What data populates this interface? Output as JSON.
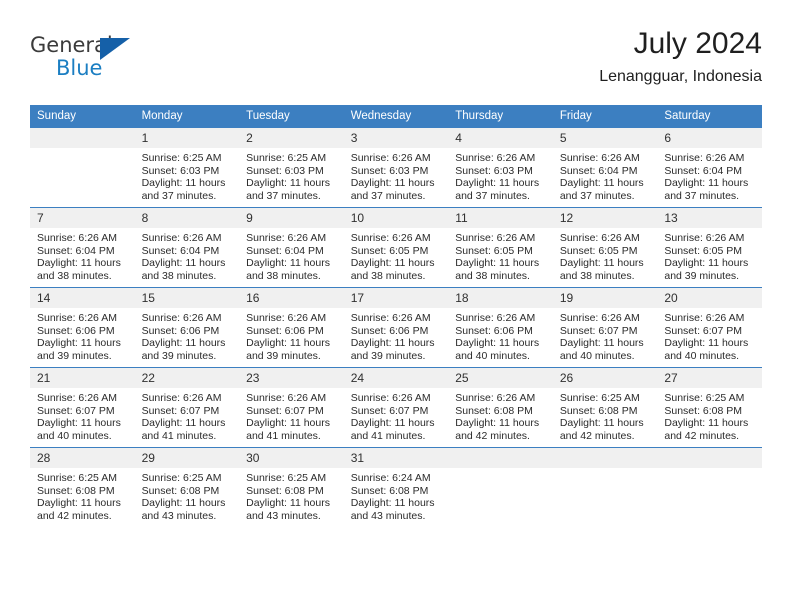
{
  "brand": {
    "name_top": "General",
    "name_bottom": "Blue",
    "triangle_color": "#1560a8",
    "blue_color": "#1b7ec2"
  },
  "header": {
    "title": "July 2024",
    "subtitle": "Lenangguar, Indonesia"
  },
  "theme": {
    "header_blue": "#3c7fc1",
    "daynum_band": "#f0f0f0",
    "grid_line": "#3c7fc1"
  },
  "weekdays": [
    "Sunday",
    "Monday",
    "Tuesday",
    "Wednesday",
    "Thursday",
    "Friday",
    "Saturday"
  ],
  "labels": {
    "sunrise": "Sunrise:",
    "sunset": "Sunset:",
    "daylight": "Daylight:"
  },
  "weeks": [
    [
      {
        "day": "",
        "sunrise": "",
        "sunset": "",
        "daylight": "",
        "empty": true
      },
      {
        "day": "1",
        "sunrise": "Sunrise: 6:25 AM",
        "sunset": "Sunset: 6:03 PM",
        "daylight": "Daylight: 11 hours and 37 minutes."
      },
      {
        "day": "2",
        "sunrise": "Sunrise: 6:25 AM",
        "sunset": "Sunset: 6:03 PM",
        "daylight": "Daylight: 11 hours and 37 minutes."
      },
      {
        "day": "3",
        "sunrise": "Sunrise: 6:26 AM",
        "sunset": "Sunset: 6:03 PM",
        "daylight": "Daylight: 11 hours and 37 minutes."
      },
      {
        "day": "4",
        "sunrise": "Sunrise: 6:26 AM",
        "sunset": "Sunset: 6:03 PM",
        "daylight": "Daylight: 11 hours and 37 minutes."
      },
      {
        "day": "5",
        "sunrise": "Sunrise: 6:26 AM",
        "sunset": "Sunset: 6:04 PM",
        "daylight": "Daylight: 11 hours and 37 minutes."
      },
      {
        "day": "6",
        "sunrise": "Sunrise: 6:26 AM",
        "sunset": "Sunset: 6:04 PM",
        "daylight": "Daylight: 11 hours and 37 minutes."
      }
    ],
    [
      {
        "day": "7",
        "sunrise": "Sunrise: 6:26 AM",
        "sunset": "Sunset: 6:04 PM",
        "daylight": "Daylight: 11 hours and 38 minutes."
      },
      {
        "day": "8",
        "sunrise": "Sunrise: 6:26 AM",
        "sunset": "Sunset: 6:04 PM",
        "daylight": "Daylight: 11 hours and 38 minutes."
      },
      {
        "day": "9",
        "sunrise": "Sunrise: 6:26 AM",
        "sunset": "Sunset: 6:04 PM",
        "daylight": "Daylight: 11 hours and 38 minutes."
      },
      {
        "day": "10",
        "sunrise": "Sunrise: 6:26 AM",
        "sunset": "Sunset: 6:05 PM",
        "daylight": "Daylight: 11 hours and 38 minutes."
      },
      {
        "day": "11",
        "sunrise": "Sunrise: 6:26 AM",
        "sunset": "Sunset: 6:05 PM",
        "daylight": "Daylight: 11 hours and 38 minutes."
      },
      {
        "day": "12",
        "sunrise": "Sunrise: 6:26 AM",
        "sunset": "Sunset: 6:05 PM",
        "daylight": "Daylight: 11 hours and 38 minutes."
      },
      {
        "day": "13",
        "sunrise": "Sunrise: 6:26 AM",
        "sunset": "Sunset: 6:05 PM",
        "daylight": "Daylight: 11 hours and 39 minutes."
      }
    ],
    [
      {
        "day": "14",
        "sunrise": "Sunrise: 6:26 AM",
        "sunset": "Sunset: 6:06 PM",
        "daylight": "Daylight: 11 hours and 39 minutes."
      },
      {
        "day": "15",
        "sunrise": "Sunrise: 6:26 AM",
        "sunset": "Sunset: 6:06 PM",
        "daylight": "Daylight: 11 hours and 39 minutes."
      },
      {
        "day": "16",
        "sunrise": "Sunrise: 6:26 AM",
        "sunset": "Sunset: 6:06 PM",
        "daylight": "Daylight: 11 hours and 39 minutes."
      },
      {
        "day": "17",
        "sunrise": "Sunrise: 6:26 AM",
        "sunset": "Sunset: 6:06 PM",
        "daylight": "Daylight: 11 hours and 39 minutes."
      },
      {
        "day": "18",
        "sunrise": "Sunrise: 6:26 AM",
        "sunset": "Sunset: 6:06 PM",
        "daylight": "Daylight: 11 hours and 40 minutes."
      },
      {
        "day": "19",
        "sunrise": "Sunrise: 6:26 AM",
        "sunset": "Sunset: 6:07 PM",
        "daylight": "Daylight: 11 hours and 40 minutes."
      },
      {
        "day": "20",
        "sunrise": "Sunrise: 6:26 AM",
        "sunset": "Sunset: 6:07 PM",
        "daylight": "Daylight: 11 hours and 40 minutes."
      }
    ],
    [
      {
        "day": "21",
        "sunrise": "Sunrise: 6:26 AM",
        "sunset": "Sunset: 6:07 PM",
        "daylight": "Daylight: 11 hours and 40 minutes."
      },
      {
        "day": "22",
        "sunrise": "Sunrise: 6:26 AM",
        "sunset": "Sunset: 6:07 PM",
        "daylight": "Daylight: 11 hours and 41 minutes."
      },
      {
        "day": "23",
        "sunrise": "Sunrise: 6:26 AM",
        "sunset": "Sunset: 6:07 PM",
        "daylight": "Daylight: 11 hours and 41 minutes."
      },
      {
        "day": "24",
        "sunrise": "Sunrise: 6:26 AM",
        "sunset": "Sunset: 6:07 PM",
        "daylight": "Daylight: 11 hours and 41 minutes."
      },
      {
        "day": "25",
        "sunrise": "Sunrise: 6:26 AM",
        "sunset": "Sunset: 6:08 PM",
        "daylight": "Daylight: 11 hours and 42 minutes."
      },
      {
        "day": "26",
        "sunrise": "Sunrise: 6:25 AM",
        "sunset": "Sunset: 6:08 PM",
        "daylight": "Daylight: 11 hours and 42 minutes."
      },
      {
        "day": "27",
        "sunrise": "Sunrise: 6:25 AM",
        "sunset": "Sunset: 6:08 PM",
        "daylight": "Daylight: 11 hours and 42 minutes."
      }
    ],
    [
      {
        "day": "28",
        "sunrise": "Sunrise: 6:25 AM",
        "sunset": "Sunset: 6:08 PM",
        "daylight": "Daylight: 11 hours and 42 minutes."
      },
      {
        "day": "29",
        "sunrise": "Sunrise: 6:25 AM",
        "sunset": "Sunset: 6:08 PM",
        "daylight": "Daylight: 11 hours and 43 minutes."
      },
      {
        "day": "30",
        "sunrise": "Sunrise: 6:25 AM",
        "sunset": "Sunset: 6:08 PM",
        "daylight": "Daylight: 11 hours and 43 minutes."
      },
      {
        "day": "31",
        "sunrise": "Sunrise: 6:24 AM",
        "sunset": "Sunset: 6:08 PM",
        "daylight": "Daylight: 11 hours and 43 minutes."
      },
      {
        "day": "",
        "sunrise": "",
        "sunset": "",
        "daylight": "",
        "empty": true
      },
      {
        "day": "",
        "sunrise": "",
        "sunset": "",
        "daylight": "",
        "empty": true
      },
      {
        "day": "",
        "sunrise": "",
        "sunset": "",
        "daylight": "",
        "empty": true
      }
    ]
  ]
}
